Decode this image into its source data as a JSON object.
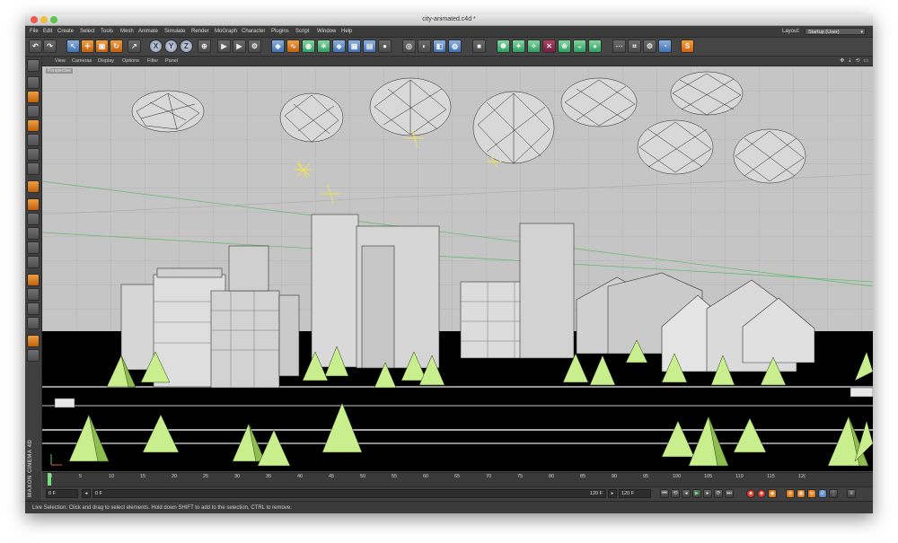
{
  "window": {
    "title": "city-animated.c4d *"
  },
  "menubar": {
    "items": [
      "File",
      "Edit",
      "Create",
      "Select",
      "Tools",
      "Mesh",
      "Animate",
      "Simulate",
      "Render",
      "MoGraph",
      "Character",
      "Plugins",
      "Script",
      "Window",
      "Help"
    ],
    "layout_label": "Layout:",
    "layout_value": "Startup (User)"
  },
  "toolbar": {
    "x_label": "X",
    "y_label": "Y",
    "z_label": "Z",
    "s_label": "S"
  },
  "viewport_menu": {
    "items": [
      "View",
      "Cameras",
      "Display",
      "Options",
      "Filter",
      "Panel"
    ],
    "controls": "✥ ⇣ ⟲ ▭",
    "label": "Perspective"
  },
  "timeline": {
    "ticks": [
      "0",
      "5",
      "10",
      "15",
      "20",
      "25",
      "30",
      "35",
      "40",
      "45",
      "50",
      "55",
      "60",
      "65",
      "70",
      "75",
      "80",
      "85",
      "90",
      "95",
      "100",
      "105",
      "110",
      "115",
      "12("
    ]
  },
  "transport": {
    "current_frame": "0 F",
    "start_frame": "0 F",
    "range_end": "120 F",
    "end_frame": "120 F"
  },
  "status": {
    "text": "Live Selection: Click and drag to select elements. Hold down SHIFT to add to the selection, CTRL to remove."
  },
  "branding": {
    "text": "MAXON CINEMA 4D"
  },
  "colors": {
    "traffic_red": "#ee5a4f",
    "traffic_yellow": "#f2bd3c",
    "traffic_green": "#5fc64d",
    "tree_light": "#c8ee8e",
    "tree_dark": "#8fbe50",
    "accent_orange": "#f39a2e"
  }
}
